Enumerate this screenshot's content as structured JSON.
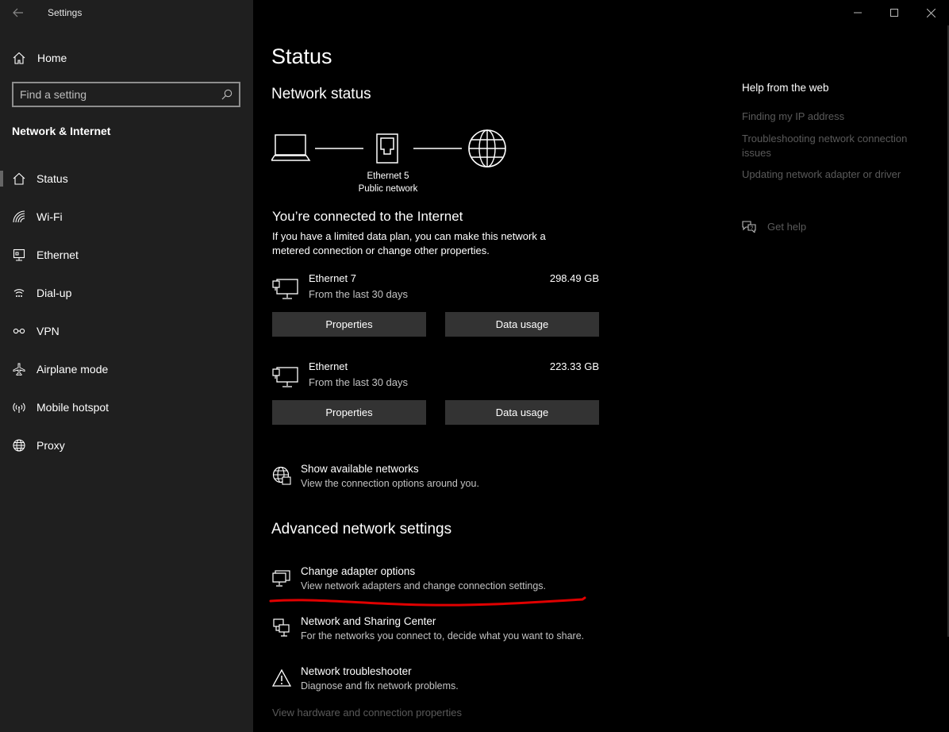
{
  "window": {
    "title": "Settings"
  },
  "sidebar": {
    "home_label": "Home",
    "search_placeholder": "Find a setting",
    "section": "Network & Internet",
    "items": [
      {
        "label": "Status",
        "icon": "home-status-icon"
      },
      {
        "label": "Wi-Fi",
        "icon": "wifi-icon"
      },
      {
        "label": "Ethernet",
        "icon": "ethernet-icon"
      },
      {
        "label": "Dial-up",
        "icon": "dialup-icon"
      },
      {
        "label": "VPN",
        "icon": "vpn-icon"
      },
      {
        "label": "Airplane mode",
        "icon": "airplane-icon"
      },
      {
        "label": "Mobile hotspot",
        "icon": "hotspot-icon"
      },
      {
        "label": "Proxy",
        "icon": "globe-icon"
      }
    ]
  },
  "main": {
    "title": "Status",
    "network_status_heading": "Network status",
    "diagram": {
      "adapter": "Ethernet 5",
      "profile": "Public network"
    },
    "connected_heading": "You’re connected to the Internet",
    "connected_desc": "If you have a limited data plan, you can make this network a metered connection or change other properties.",
    "connections": [
      {
        "name": "Ethernet 7",
        "period": "From the last 30 days",
        "usage": "298.49 GB",
        "properties_label": "Properties",
        "data_usage_label": "Data usage"
      },
      {
        "name": "Ethernet",
        "period": "From the last 30 days",
        "usage": "223.33 GB",
        "properties_label": "Properties",
        "data_usage_label": "Data usage"
      }
    ],
    "show_networks": {
      "title": "Show available networks",
      "desc": "View the connection options around you."
    },
    "advanced_heading": "Advanced network settings",
    "advanced": [
      {
        "title": "Change adapter options",
        "desc": "View network adapters and change connection settings."
      },
      {
        "title": "Network and Sharing Center",
        "desc": "For the networks you connect to, decide what you want to share."
      },
      {
        "title": "Network troubleshooter",
        "desc": "Diagnose and fix network problems."
      }
    ],
    "footer_link": "View hardware and connection properties"
  },
  "help": {
    "heading": "Help from the web",
    "links": [
      "Finding my IP address",
      "Troubleshooting network connection issues",
      "Updating network adapter or driver"
    ],
    "get_help": "Get help"
  },
  "colors": {
    "sidebar_bg": "#1f1f1f",
    "main_bg": "#000000",
    "button_bg": "#333333",
    "annotation": "#e00000",
    "muted_link": "#5a5a5a"
  }
}
